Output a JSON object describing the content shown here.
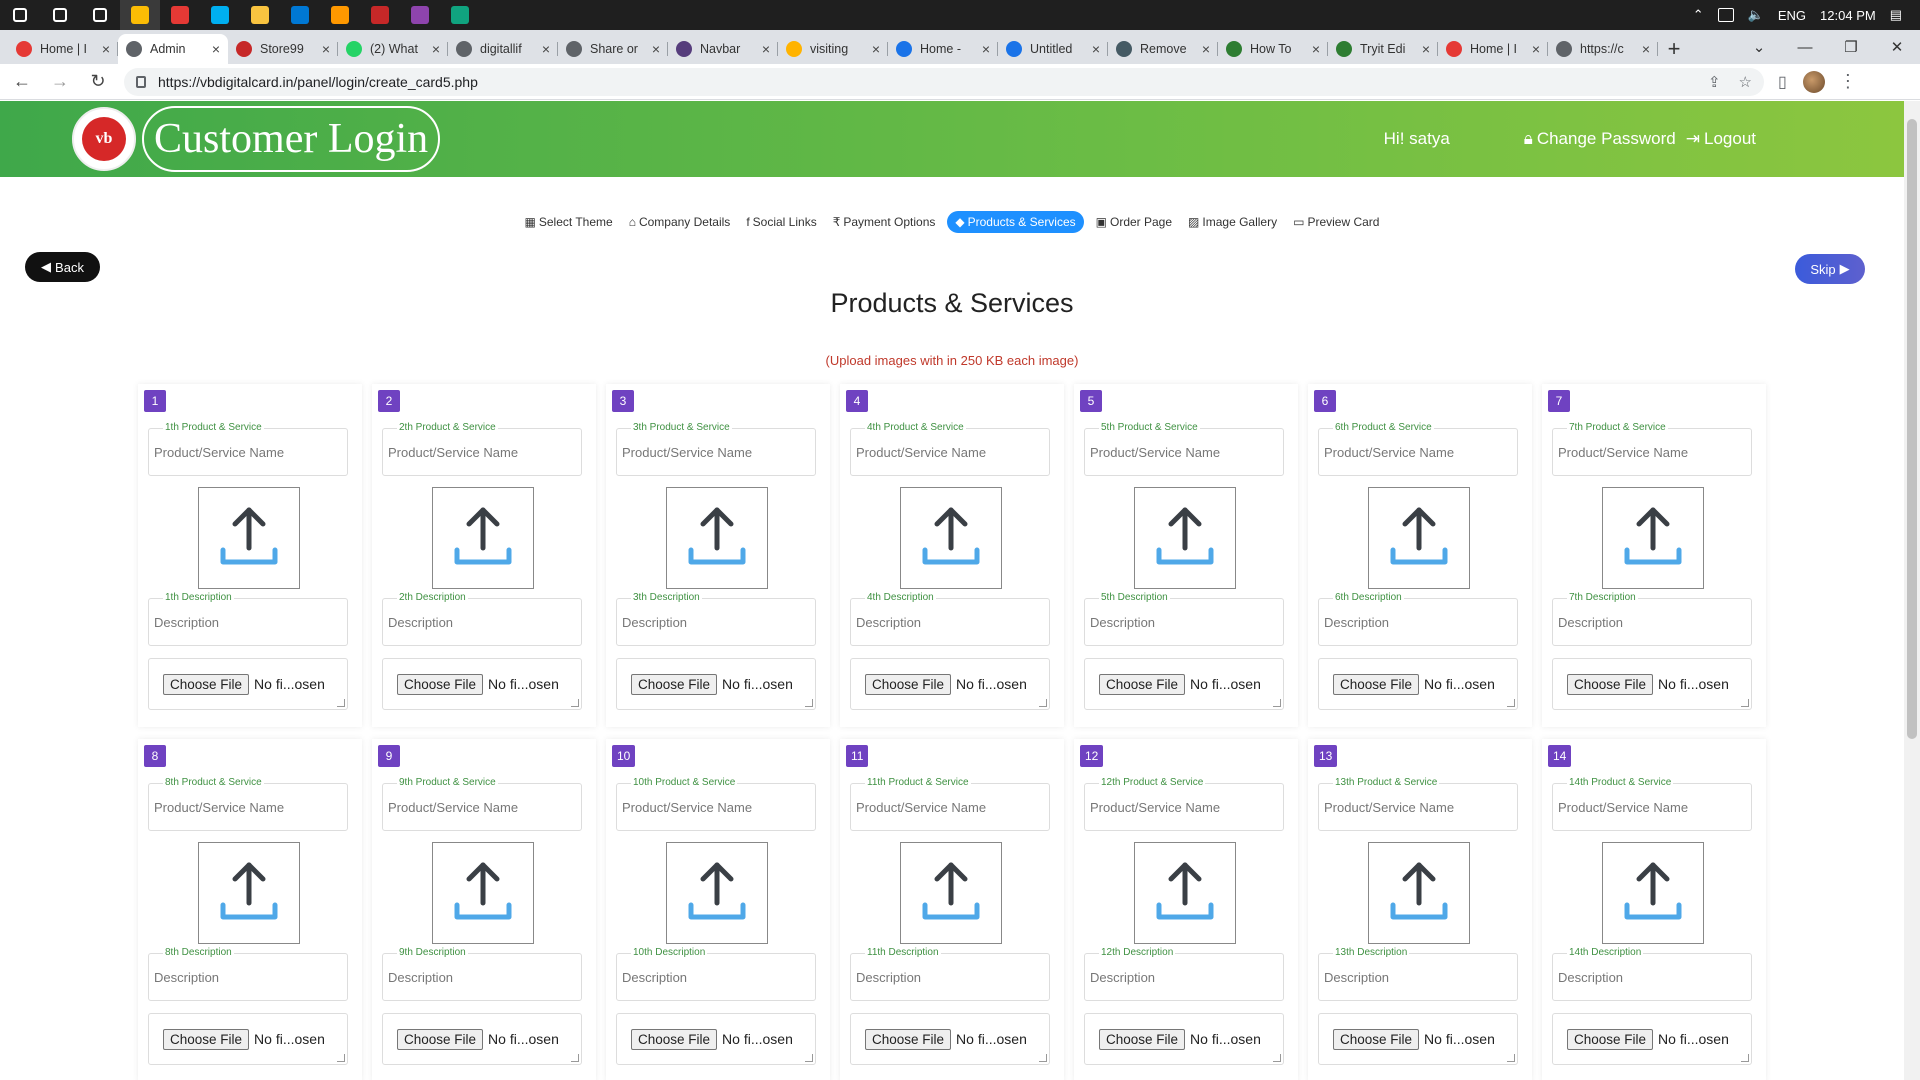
{
  "taskbar": {
    "apps": [
      {
        "name": "windows-start-icon",
        "color": "#ffffff"
      },
      {
        "name": "search-icon",
        "color": "#ffffff"
      },
      {
        "name": "task-view-icon",
        "color": "#ffffff"
      },
      {
        "name": "chrome-icon",
        "color": "#fbbc05"
      },
      {
        "name": "anydesk-icon",
        "color": "#e53935"
      },
      {
        "name": "skype-icon",
        "color": "#00aff0"
      },
      {
        "name": "file-explorer-icon",
        "color": "#f9c440"
      },
      {
        "name": "mail-icon",
        "color": "#0078d4"
      },
      {
        "name": "sublime-icon",
        "color": "#ff9800"
      },
      {
        "name": "flag-app-icon",
        "color": "#c62828"
      },
      {
        "name": "github-icon",
        "color": "#8e44ad"
      },
      {
        "name": "chatgpt-icon",
        "color": "#10a37f"
      }
    ],
    "lang": "ENG",
    "time": "12:04 PM"
  },
  "tabs": [
    {
      "label": "Home | I",
      "fav": "#e53935",
      "active": false
    },
    {
      "label": "Admin",
      "fav": "#5f6368",
      "active": true
    },
    {
      "label": "Store99",
      "fav": "#c62828",
      "active": false
    },
    {
      "label": "(2) What",
      "fav": "#25d366",
      "active": false
    },
    {
      "label": "digitallif",
      "fav": "#5f6368",
      "active": false
    },
    {
      "label": "Share or",
      "fav": "#5f6368",
      "active": false
    },
    {
      "label": "Navbar",
      "fav": "#563d7c",
      "active": false
    },
    {
      "label": "visiting",
      "fav": "#ffb300",
      "active": false
    },
    {
      "label": "Home -",
      "fav": "#1a73e8",
      "active": false
    },
    {
      "label": "Untitled",
      "fav": "#1a73e8",
      "active": false
    },
    {
      "label": "Remove",
      "fav": "#455a64",
      "active": false
    },
    {
      "label": "How To",
      "fav": "#2e7d32",
      "active": false
    },
    {
      "label": "Tryit Edi",
      "fav": "#2e7d32",
      "active": false
    },
    {
      "label": "Home | I",
      "fav": "#e53935",
      "active": false
    },
    {
      "label": "https://c",
      "fav": "#5f6368",
      "active": false
    }
  ],
  "address": {
    "url": "https://vbdigitalcard.in/panel/login/create_card5.php"
  },
  "header": {
    "logo_text": "vb",
    "title": "Customer Login",
    "greeting": "Hi! satya",
    "change_password": "Change Password",
    "logout": "Logout"
  },
  "steps": [
    {
      "icon": "▦",
      "label": "Select Theme",
      "active": false
    },
    {
      "icon": "⌂",
      "label": "Company Details",
      "active": false
    },
    {
      "icon": "f",
      "label": "Social Links",
      "active": false
    },
    {
      "icon": "₹",
      "label": "Payment Options",
      "active": false
    },
    {
      "icon": "◆",
      "label": "Products & Services",
      "active": true
    },
    {
      "icon": "▣",
      "label": "Order Page",
      "active": false
    },
    {
      "icon": "▨",
      "label": "Image Gallery",
      "active": false
    },
    {
      "icon": "▭",
      "label": "Preview Card",
      "active": false
    }
  ],
  "buttons": {
    "back": "Back",
    "skip": "Skip"
  },
  "page": {
    "title": "Products & Services",
    "note": "(Upload images with in 250 KB each image)"
  },
  "form": {
    "name_placeholder": "Product/Service Name",
    "desc_placeholder": "Description",
    "choose_file": "Choose File",
    "no_file": "No fi...osen"
  },
  "cards": [
    {
      "num": "1",
      "name_label": "1th Product & Service",
      "desc_label": "1th Description"
    },
    {
      "num": "2",
      "name_label": "2th Product & Service",
      "desc_label": "2th Description"
    },
    {
      "num": "3",
      "name_label": "3th Product & Service",
      "desc_label": "3th Description"
    },
    {
      "num": "4",
      "name_label": "4th Product & Service",
      "desc_label": "4th Description"
    },
    {
      "num": "5",
      "name_label": "5th Product & Service",
      "desc_label": "5th Description"
    },
    {
      "num": "6",
      "name_label": "6th Product & Service",
      "desc_label": "6th Description"
    },
    {
      "num": "7",
      "name_label": "7th Product & Service",
      "desc_label": "7th Description"
    },
    {
      "num": "8",
      "name_label": "8th Product & Service",
      "desc_label": "8th Description"
    },
    {
      "num": "9",
      "name_label": "9th Product & Service",
      "desc_label": "9th Description"
    },
    {
      "num": "10",
      "name_label": "10th Product & Service",
      "desc_label": "10th Description"
    },
    {
      "num": "11",
      "name_label": "11th Product & Service",
      "desc_label": "11th Description"
    },
    {
      "num": "12",
      "name_label": "12th Product & Service",
      "desc_label": "12th Description"
    },
    {
      "num": "13",
      "name_label": "13th Product & Service",
      "desc_label": "13th Description"
    },
    {
      "num": "14",
      "name_label": "14th Product & Service",
      "desc_label": "14th Description"
    }
  ],
  "colors": {
    "header_green": "#6cbd45",
    "active_step": "#1e90ff",
    "badge": "#6f42c1",
    "label_green": "#3f9142",
    "note_red": "#c0392b"
  }
}
